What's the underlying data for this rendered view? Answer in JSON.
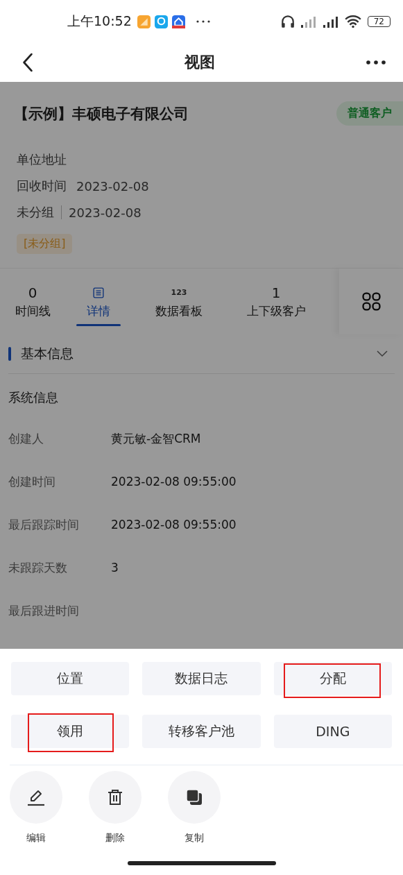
{
  "status_bar": {
    "time": "上午10:52",
    "battery": "72"
  },
  "nav": {
    "title": "视图"
  },
  "customer": {
    "name": "【示例】丰硕电子有限公司",
    "tag": "普通客户",
    "address_label": "单位地址",
    "recycle_label": "回收时间",
    "recycle_date": "2023-02-08",
    "group": "未分组",
    "group_date": "2023-02-08",
    "group_tag": "[未分组]"
  },
  "tabs": [
    {
      "kind": "count",
      "count": "0",
      "label": "时间线",
      "selected": false
    },
    {
      "kind": "list",
      "label": "详情",
      "selected": true
    },
    {
      "kind": "digits",
      "icon_text": "123",
      "label": "数据看板",
      "selected": false
    },
    {
      "kind": "count",
      "count": "1",
      "label": "上下级客户",
      "selected": false
    }
  ],
  "section": {
    "title": "基本信息",
    "subtitle": "系统信息"
  },
  "fields": [
    {
      "label": "创建人",
      "value": "黄元敏-金智CRM"
    },
    {
      "label": "创建时间",
      "value": "2023-02-08 09:55:00"
    },
    {
      "label": "最后跟踪时间",
      "value": "2023-02-08 09:55:00"
    },
    {
      "label": "未跟踪天数",
      "value": "3"
    },
    {
      "label": "最后跟进时间"
    }
  ],
  "actions": [
    {
      "label": "位置",
      "highlighted": false
    },
    {
      "label": "数据日志",
      "highlighted": false
    },
    {
      "label": "分配",
      "highlighted": true
    },
    {
      "label": "领用",
      "highlighted": true
    },
    {
      "label": "转移客户池",
      "highlighted": false
    },
    {
      "label": "DING",
      "highlighted": false
    }
  ],
  "tools": [
    {
      "kind": "edit",
      "label": "编辑"
    },
    {
      "kind": "delete",
      "label": "删除"
    },
    {
      "kind": "copy",
      "label": "复制"
    }
  ]
}
